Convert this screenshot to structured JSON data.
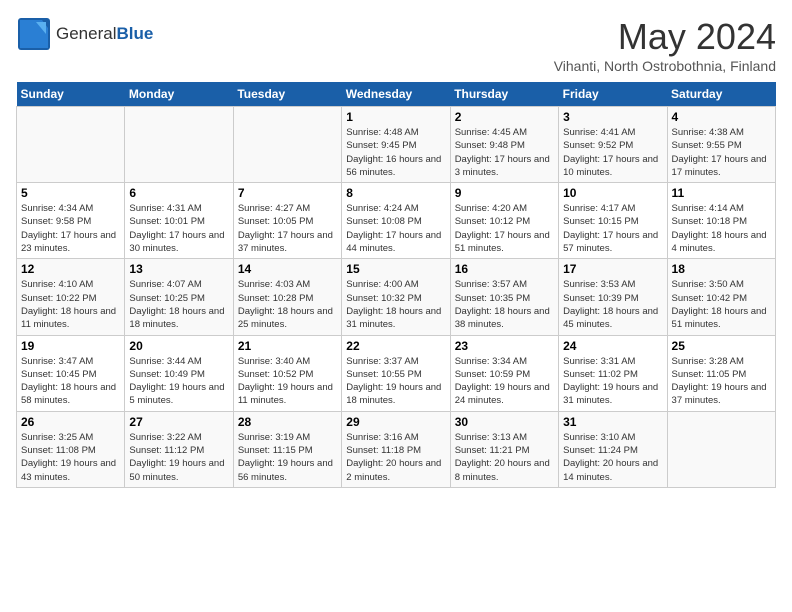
{
  "logo": {
    "general": "General",
    "blue": "Blue"
  },
  "title": "May 2024",
  "subtitle": "Vihanti, North Ostrobothnia, Finland",
  "days_of_week": [
    "Sunday",
    "Monday",
    "Tuesday",
    "Wednesday",
    "Thursday",
    "Friday",
    "Saturday"
  ],
  "weeks": [
    [
      {
        "num": "",
        "sunrise": "",
        "sunset": "",
        "daylight": ""
      },
      {
        "num": "",
        "sunrise": "",
        "sunset": "",
        "daylight": ""
      },
      {
        "num": "",
        "sunrise": "",
        "sunset": "",
        "daylight": ""
      },
      {
        "num": "1",
        "sunrise": "Sunrise: 4:48 AM",
        "sunset": "Sunset: 9:45 PM",
        "daylight": "Daylight: 16 hours and 56 minutes."
      },
      {
        "num": "2",
        "sunrise": "Sunrise: 4:45 AM",
        "sunset": "Sunset: 9:48 PM",
        "daylight": "Daylight: 17 hours and 3 minutes."
      },
      {
        "num": "3",
        "sunrise": "Sunrise: 4:41 AM",
        "sunset": "Sunset: 9:52 PM",
        "daylight": "Daylight: 17 hours and 10 minutes."
      },
      {
        "num": "4",
        "sunrise": "Sunrise: 4:38 AM",
        "sunset": "Sunset: 9:55 PM",
        "daylight": "Daylight: 17 hours and 17 minutes."
      }
    ],
    [
      {
        "num": "5",
        "sunrise": "Sunrise: 4:34 AM",
        "sunset": "Sunset: 9:58 PM",
        "daylight": "Daylight: 17 hours and 23 minutes."
      },
      {
        "num": "6",
        "sunrise": "Sunrise: 4:31 AM",
        "sunset": "Sunset: 10:01 PM",
        "daylight": "Daylight: 17 hours and 30 minutes."
      },
      {
        "num": "7",
        "sunrise": "Sunrise: 4:27 AM",
        "sunset": "Sunset: 10:05 PM",
        "daylight": "Daylight: 17 hours and 37 minutes."
      },
      {
        "num": "8",
        "sunrise": "Sunrise: 4:24 AM",
        "sunset": "Sunset: 10:08 PM",
        "daylight": "Daylight: 17 hours and 44 minutes."
      },
      {
        "num": "9",
        "sunrise": "Sunrise: 4:20 AM",
        "sunset": "Sunset: 10:12 PM",
        "daylight": "Daylight: 17 hours and 51 minutes."
      },
      {
        "num": "10",
        "sunrise": "Sunrise: 4:17 AM",
        "sunset": "Sunset: 10:15 PM",
        "daylight": "Daylight: 17 hours and 57 minutes."
      },
      {
        "num": "11",
        "sunrise": "Sunrise: 4:14 AM",
        "sunset": "Sunset: 10:18 PM",
        "daylight": "Daylight: 18 hours and 4 minutes."
      }
    ],
    [
      {
        "num": "12",
        "sunrise": "Sunrise: 4:10 AM",
        "sunset": "Sunset: 10:22 PM",
        "daylight": "Daylight: 18 hours and 11 minutes."
      },
      {
        "num": "13",
        "sunrise": "Sunrise: 4:07 AM",
        "sunset": "Sunset: 10:25 PM",
        "daylight": "Daylight: 18 hours and 18 minutes."
      },
      {
        "num": "14",
        "sunrise": "Sunrise: 4:03 AM",
        "sunset": "Sunset: 10:28 PM",
        "daylight": "Daylight: 18 hours and 25 minutes."
      },
      {
        "num": "15",
        "sunrise": "Sunrise: 4:00 AM",
        "sunset": "Sunset: 10:32 PM",
        "daylight": "Daylight: 18 hours and 31 minutes."
      },
      {
        "num": "16",
        "sunrise": "Sunrise: 3:57 AM",
        "sunset": "Sunset: 10:35 PM",
        "daylight": "Daylight: 18 hours and 38 minutes."
      },
      {
        "num": "17",
        "sunrise": "Sunrise: 3:53 AM",
        "sunset": "Sunset: 10:39 PM",
        "daylight": "Daylight: 18 hours and 45 minutes."
      },
      {
        "num": "18",
        "sunrise": "Sunrise: 3:50 AM",
        "sunset": "Sunset: 10:42 PM",
        "daylight": "Daylight: 18 hours and 51 minutes."
      }
    ],
    [
      {
        "num": "19",
        "sunrise": "Sunrise: 3:47 AM",
        "sunset": "Sunset: 10:45 PM",
        "daylight": "Daylight: 18 hours and 58 minutes."
      },
      {
        "num": "20",
        "sunrise": "Sunrise: 3:44 AM",
        "sunset": "Sunset: 10:49 PM",
        "daylight": "Daylight: 19 hours and 5 minutes."
      },
      {
        "num": "21",
        "sunrise": "Sunrise: 3:40 AM",
        "sunset": "Sunset: 10:52 PM",
        "daylight": "Daylight: 19 hours and 11 minutes."
      },
      {
        "num": "22",
        "sunrise": "Sunrise: 3:37 AM",
        "sunset": "Sunset: 10:55 PM",
        "daylight": "Daylight: 19 hours and 18 minutes."
      },
      {
        "num": "23",
        "sunrise": "Sunrise: 3:34 AM",
        "sunset": "Sunset: 10:59 PM",
        "daylight": "Daylight: 19 hours and 24 minutes."
      },
      {
        "num": "24",
        "sunrise": "Sunrise: 3:31 AM",
        "sunset": "Sunset: 11:02 PM",
        "daylight": "Daylight: 19 hours and 31 minutes."
      },
      {
        "num": "25",
        "sunrise": "Sunrise: 3:28 AM",
        "sunset": "Sunset: 11:05 PM",
        "daylight": "Daylight: 19 hours and 37 minutes."
      }
    ],
    [
      {
        "num": "26",
        "sunrise": "Sunrise: 3:25 AM",
        "sunset": "Sunset: 11:08 PM",
        "daylight": "Daylight: 19 hours and 43 minutes."
      },
      {
        "num": "27",
        "sunrise": "Sunrise: 3:22 AM",
        "sunset": "Sunset: 11:12 PM",
        "daylight": "Daylight: 19 hours and 50 minutes."
      },
      {
        "num": "28",
        "sunrise": "Sunrise: 3:19 AM",
        "sunset": "Sunset: 11:15 PM",
        "daylight": "Daylight: 19 hours and 56 minutes."
      },
      {
        "num": "29",
        "sunrise": "Sunrise: 3:16 AM",
        "sunset": "Sunset: 11:18 PM",
        "daylight": "Daylight: 20 hours and 2 minutes."
      },
      {
        "num": "30",
        "sunrise": "Sunrise: 3:13 AM",
        "sunset": "Sunset: 11:21 PM",
        "daylight": "Daylight: 20 hours and 8 minutes."
      },
      {
        "num": "31",
        "sunrise": "Sunrise: 3:10 AM",
        "sunset": "Sunset: 11:24 PM",
        "daylight": "Daylight: 20 hours and 14 minutes."
      },
      {
        "num": "",
        "sunrise": "",
        "sunset": "",
        "daylight": ""
      }
    ]
  ]
}
